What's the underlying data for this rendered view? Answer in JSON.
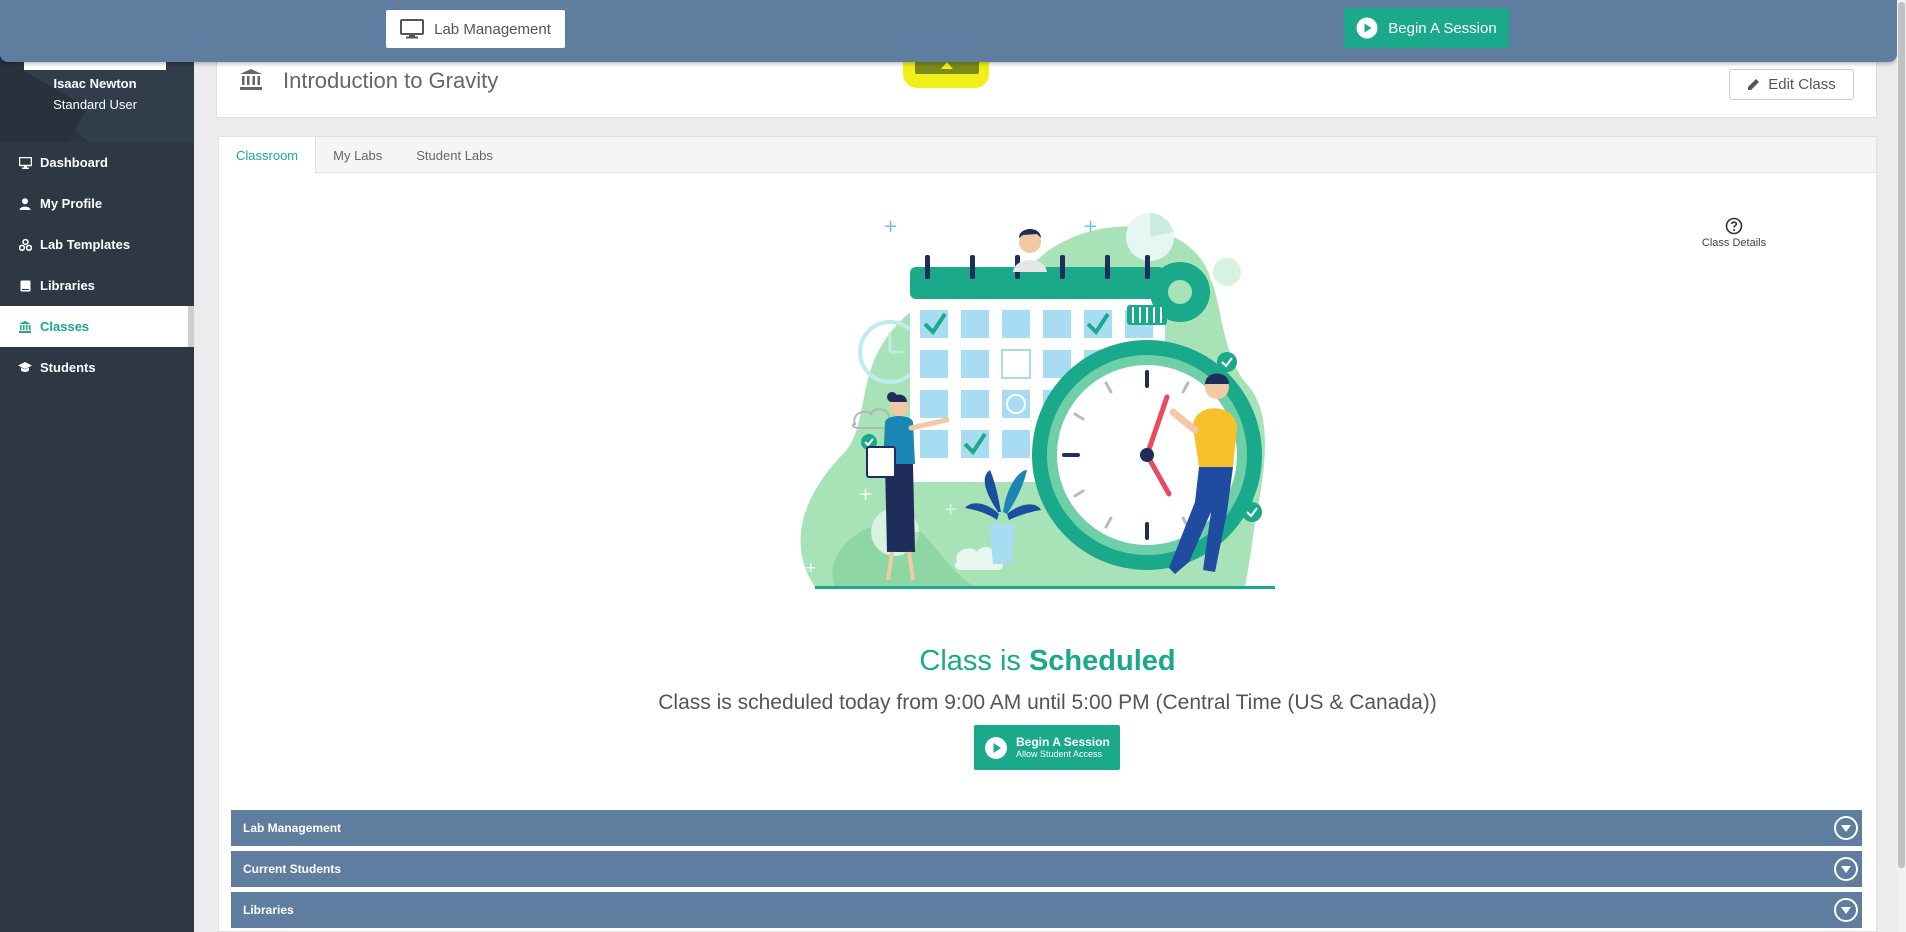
{
  "user": {
    "name": "Isaac Newton",
    "role": "Standard User"
  },
  "sidebar": {
    "items": [
      {
        "label": "Dashboard",
        "icon": "monitor-icon"
      },
      {
        "label": "My Profile",
        "icon": "user-icon"
      },
      {
        "label": "Lab Templates",
        "icon": "cubes-icon"
      },
      {
        "label": "Libraries",
        "icon": "book-icon"
      },
      {
        "label": "Classes",
        "icon": "institution-icon",
        "active": true
      },
      {
        "label": "Students",
        "icon": "graduation-cap-icon"
      }
    ]
  },
  "topbar": {
    "lab_management_label": "Lab Management",
    "begin_session_label": "Begin A Session"
  },
  "class": {
    "title": "Introduction to Gravity",
    "edit_label": "Edit Class"
  },
  "tabs": [
    {
      "label": "Classroom",
      "active": true
    },
    {
      "label": "My Labs"
    },
    {
      "label": "Student Labs"
    }
  ],
  "class_details_label": "Class Details",
  "status": {
    "prefix": "Class is",
    "state": "Scheduled",
    "schedule_text": "Class is scheduled today from 9:00 AM until 5:00 PM (Central Time (US & Canada))"
  },
  "session_button": {
    "title": "Begin A Session",
    "subtitle": "Allow Student Access"
  },
  "accordions": [
    {
      "label": "Lab Management"
    },
    {
      "label": "Current Students"
    },
    {
      "label": "Libraries"
    }
  ],
  "colors": {
    "accent": "#1aa98a",
    "topbar": "#5e7d9f",
    "sidebar": "#2d3844",
    "highlight": "#f0ef1a"
  }
}
